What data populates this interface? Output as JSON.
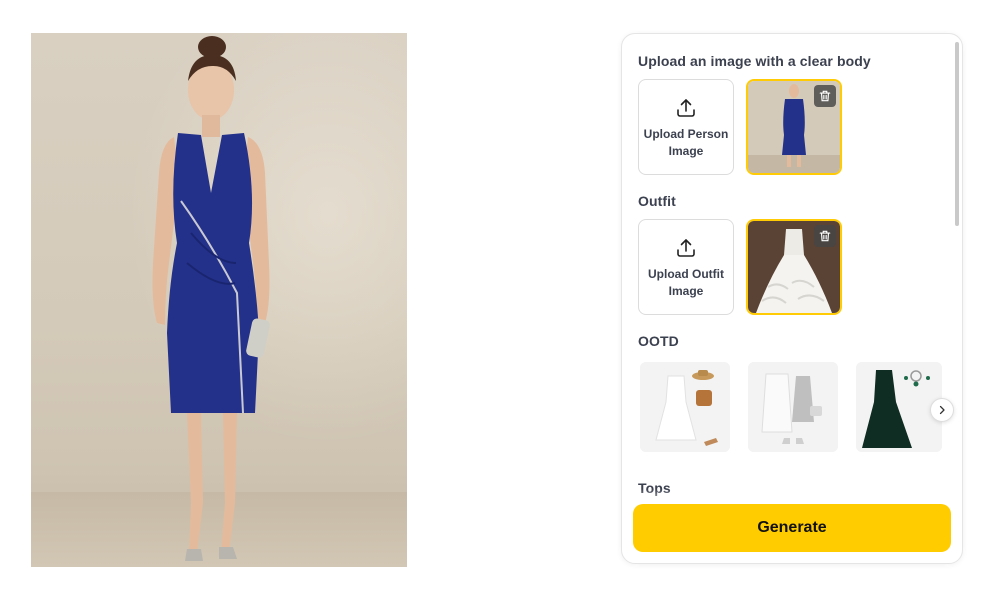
{
  "preview": {
    "image": "woman-in-navy-dress-photo"
  },
  "panel": {
    "person_section": {
      "title": "Upload an image with a clear body",
      "upload_label": "Upload Person Image",
      "thumbnail": "navy-dress-thumbnail"
    },
    "outfit_section": {
      "title": "Outfit",
      "upload_label": "Upload Outfit Image",
      "thumbnail": "white-ruffled-gown-thumbnail"
    },
    "ootd_section": {
      "title": "OOTD",
      "items": [
        "white-sundress-with-hat-and-bag",
        "white-coat-with-silver-dress",
        "dark-green-velvet-gown"
      ]
    },
    "tops_section": {
      "title": "Tops"
    },
    "generate_label": "Generate"
  },
  "colors": {
    "accent": "#ffcc00",
    "thumb_border": "#ffcb05",
    "label_text": "#3c4150"
  }
}
